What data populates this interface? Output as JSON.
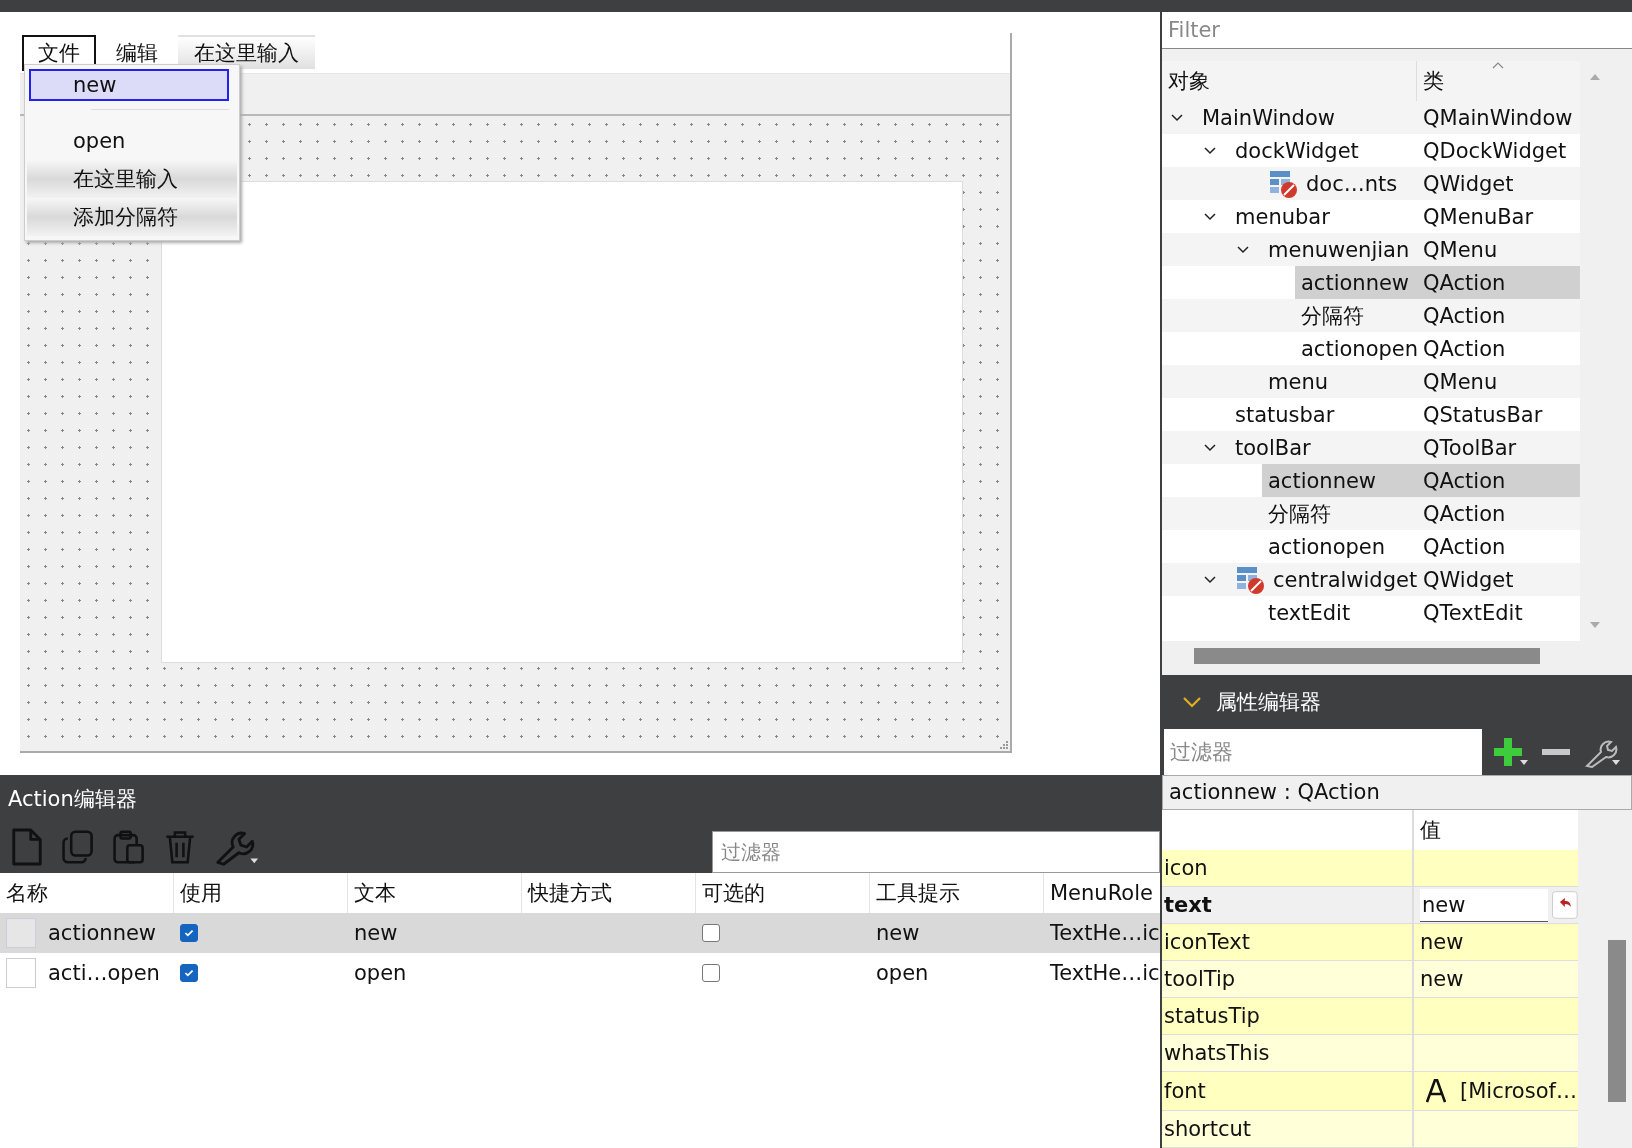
{
  "form": {
    "menus": [
      {
        "label": "文件",
        "kind": "menu",
        "selected": true
      },
      {
        "label": "编辑",
        "kind": "menu",
        "selected": false
      },
      {
        "label": "在这里输入",
        "kind": "add",
        "selected": false
      }
    ],
    "dropdown": [
      {
        "label": "new",
        "kind": "action",
        "selected": true
      },
      {
        "kind": "separator"
      },
      {
        "label": "open",
        "kind": "action",
        "selected": false
      },
      {
        "label": "在这里输入",
        "kind": "add"
      },
      {
        "label": "添加分隔符",
        "kind": "add"
      }
    ]
  },
  "action_editor": {
    "title": "Action编辑器",
    "filter": {
      "placeholder": "过滤器"
    },
    "columns": [
      "名称",
      "使用",
      "文本",
      "快捷方式",
      "可选的",
      "工具提示",
      "MenuRole"
    ],
    "rows": [
      {
        "name": "actionnew",
        "used": true,
        "text": "new",
        "checkable": false,
        "tooltip": "new",
        "menu_role": "TextHe…ic",
        "selected": true
      },
      {
        "name": "acti…open",
        "used": true,
        "text": "open",
        "checkable": false,
        "tooltip": "open",
        "menu_role": "TextHe…ic",
        "selected": false
      }
    ]
  },
  "object_inspector": {
    "filter": {
      "placeholder": "Filter"
    },
    "columns": [
      "对象",
      "类"
    ],
    "tree": [
      {
        "name": "MainWindow",
        "class": "QMainWindow",
        "expanded": true,
        "selected": false,
        "children": [
          {
            "name": "dockWidget",
            "class": "QDockWidget",
            "expanded": true,
            "selected": false,
            "children": [
              {
                "name": "doc…nts",
                "class": "QWidget",
                "kind": "widget",
                "selected": false
              }
            ]
          },
          {
            "name": "menubar",
            "class": "QMenuBar",
            "expanded": true,
            "selected": false,
            "children": [
              {
                "name": "menuwenjian",
                "class": "QMenu",
                "expanded": true,
                "selected": false,
                "children": [
                  {
                    "name": "actionnew",
                    "class": "QAction",
                    "selected": true
                  },
                  {
                    "name": "分隔符",
                    "class": "QAction",
                    "selected": false
                  },
                  {
                    "name": "actionopen",
                    "class": "QAction",
                    "selected": false
                  }
                ]
              },
              {
                "name": "menu",
                "class": "QMenu",
                "selected": false
              }
            ]
          },
          {
            "name": "statusbar",
            "class": "QStatusBar",
            "selected": false
          },
          {
            "name": "toolBar",
            "class": "QToolBar",
            "expanded": true,
            "selected": false,
            "children": [
              {
                "name": "actionnew",
                "class": "QAction",
                "selected": true
              },
              {
                "name": "分隔符",
                "class": "QAction",
                "selected": false
              },
              {
                "name": "actionopen",
                "class": "QAction",
                "selected": false
              }
            ]
          },
          {
            "name": "centralwidget",
            "class": "QWidget",
            "kind": "widget",
            "expanded": true,
            "selected": false,
            "children": [
              {
                "name": "textEdit",
                "class": "QTextEdit",
                "selected": false
              }
            ]
          }
        ]
      }
    ]
  },
  "property_editor": {
    "title": "属性编辑器",
    "expanded": true,
    "filter": {
      "placeholder": "过滤器"
    },
    "object": "actionnew : QAction",
    "value_header": "值",
    "properties": [
      {
        "name": "icon",
        "kind": "plain",
        "modified": false
      },
      {
        "name": "text",
        "value": "new",
        "kind": "edit",
        "modified": true
      },
      {
        "name": "iconText",
        "value": "new",
        "kind": "plain",
        "modified": false
      },
      {
        "name": "toolTip",
        "value": "new",
        "kind": "plain",
        "modified": false
      },
      {
        "name": "statusTip",
        "kind": "plain",
        "modified": false
      },
      {
        "name": "whatsThis",
        "kind": "plain",
        "modified": false
      },
      {
        "name": "font",
        "value": "[Microsof…",
        "kind": "font",
        "modified": false
      },
      {
        "name": "shortcut",
        "kind": "plain",
        "modified": false
      }
    ]
  }
}
